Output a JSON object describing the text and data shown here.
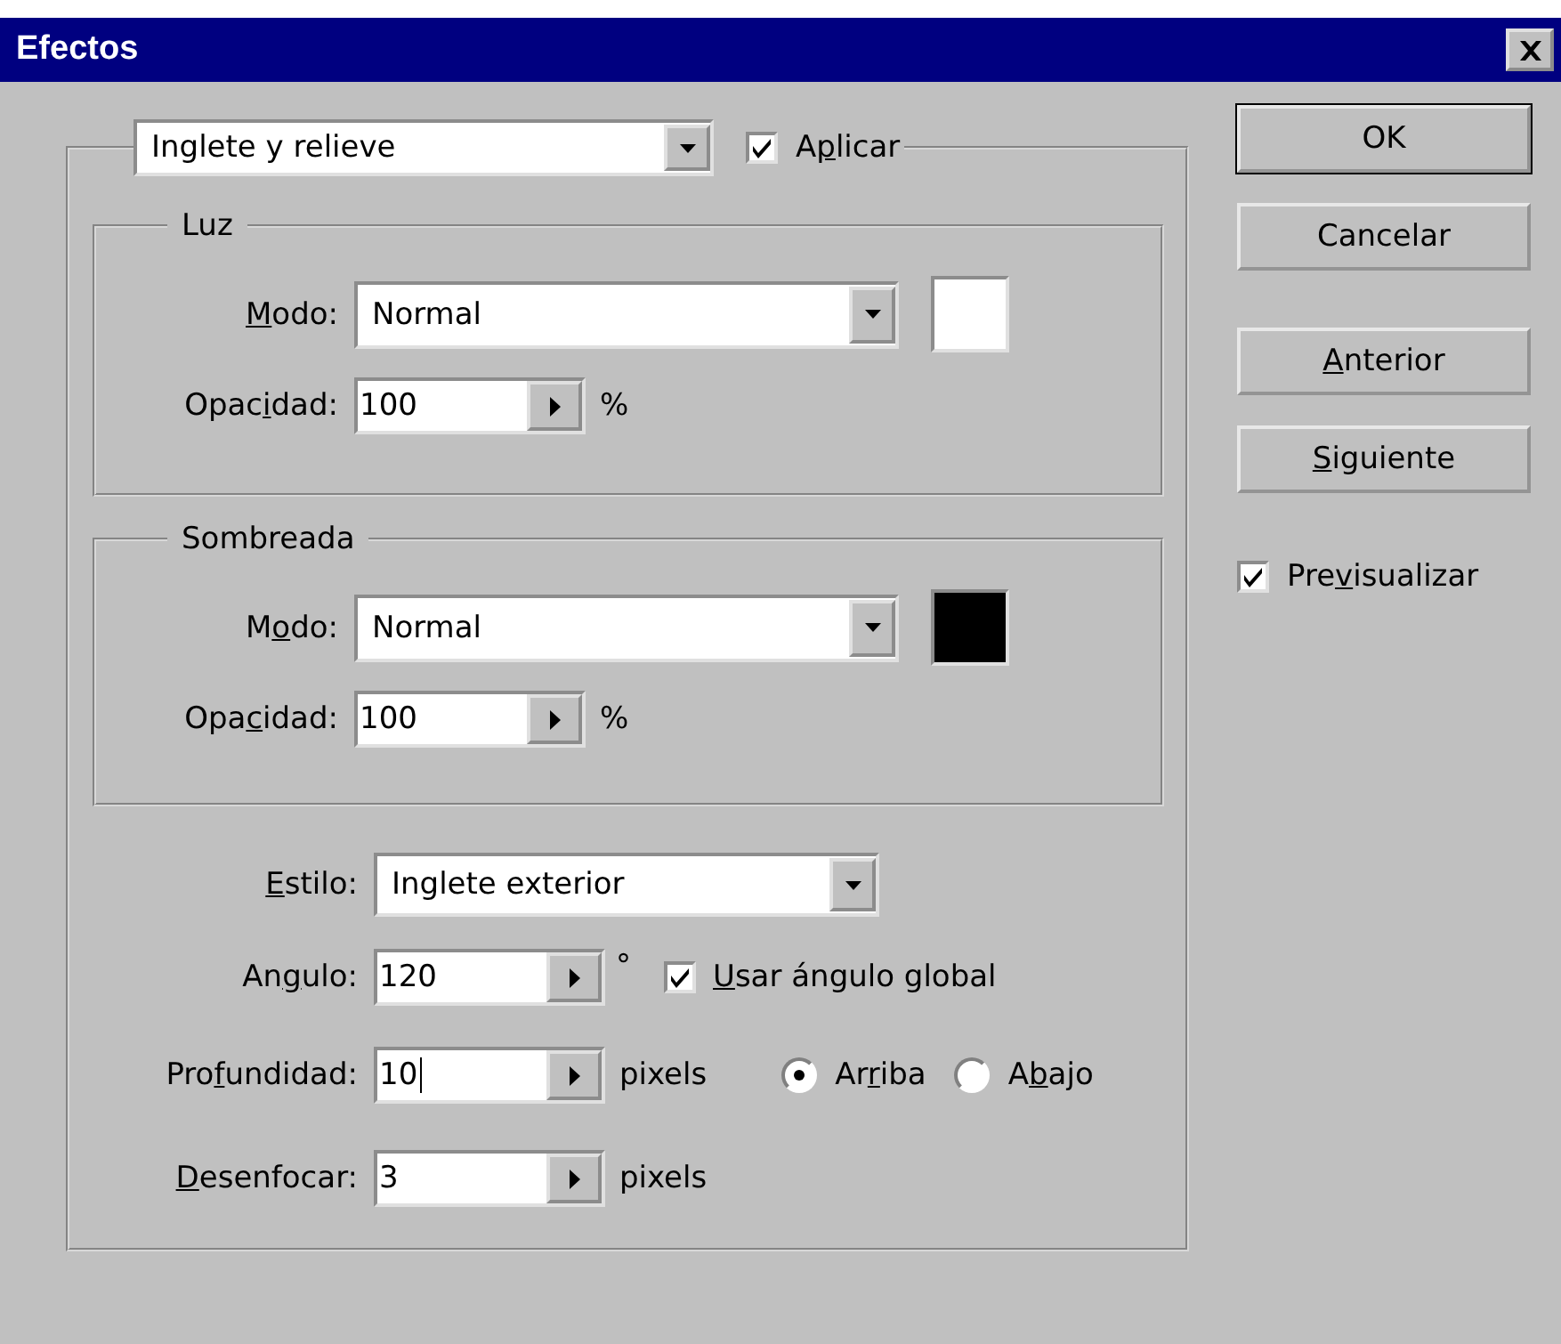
{
  "window": {
    "title": "Efectos"
  },
  "effect": {
    "value": "Inglete y relieve"
  },
  "apply": {
    "label": [
      {
        "text": "A",
        "underlined": false
      },
      {
        "text": "p",
        "underlined": true
      },
      {
        "text": "licar",
        "underlined": false
      }
    ],
    "checked": true
  },
  "groups": [
    {
      "title": "Luz",
      "mode_label": [
        {
          "text": "M",
          "underlined": true
        },
        {
          "text": "odo:",
          "underlined": false
        }
      ],
      "mode": "Normal",
      "color": "#ffffff",
      "opacity_label": [
        {
          "text": "Opac",
          "underlined": false
        },
        {
          "text": "i",
          "underlined": true
        },
        {
          "text": "dad:",
          "underlined": false
        }
      ],
      "opacity": "100",
      "unit": "%"
    },
    {
      "title": "Sombreada",
      "mode_label": [
        {
          "text": "M",
          "underlined": false
        },
        {
          "text": "o",
          "underlined": true
        },
        {
          "text": "do:",
          "underlined": false
        }
      ],
      "mode": "Normal",
      "color": "#000000",
      "opacity_label": [
        {
          "text": "Opa",
          "underlined": false
        },
        {
          "text": "c",
          "underlined": true
        },
        {
          "text": "idad:",
          "underlined": false
        }
      ],
      "opacity": "100",
      "unit": "%"
    }
  ],
  "style": {
    "label": [
      {
        "text": "E",
        "underlined": true
      },
      {
        "text": "stilo:",
        "underlined": false
      }
    ],
    "value": "Inglete exterior"
  },
  "angle": {
    "label": [
      {
        "text": "An",
        "underlined": false
      },
      {
        "text": "g",
        "underlined": true
      },
      {
        "text": "ulo:",
        "underlined": false
      }
    ],
    "value": "120",
    "unit": "°",
    "global": {
      "label": [
        {
          "text": "U",
          "underlined": true
        },
        {
          "text": "sar ángulo global",
          "underlined": false
        }
      ],
      "checked": true
    }
  },
  "depth": {
    "label": [
      {
        "text": "Pro",
        "underlined": false
      },
      {
        "text": "f",
        "underlined": true
      },
      {
        "text": "undidad:",
        "underlined": false
      }
    ],
    "value": "10",
    "focused": true,
    "unit": "pixels",
    "directions": [
      {
        "label": [
          {
            "text": "Ar",
            "underlined": false
          },
          {
            "text": "r",
            "underlined": true
          },
          {
            "text": "iba",
            "underlined": false
          }
        ],
        "selected": true
      },
      {
        "label": [
          {
            "text": "A",
            "underlined": false
          },
          {
            "text": "b",
            "underlined": true
          },
          {
            "text": "ajo",
            "underlined": false
          }
        ],
        "selected": false
      }
    ]
  },
  "blur": {
    "label": [
      {
        "text": "D",
        "underlined": true
      },
      {
        "text": "esenfocar:",
        "underlined": false
      }
    ],
    "value": "3",
    "unit": "pixels"
  },
  "buttons": [
    {
      "label": [
        {
          "text": "OK",
          "underlined": false
        }
      ],
      "default": true
    },
    {
      "label": [
        {
          "text": "Cancelar",
          "underlined": false
        }
      ],
      "default": false
    },
    {
      "label": [
        {
          "text": "A",
          "underlined": true
        },
        {
          "text": "nterior",
          "underlined": false
        }
      ],
      "default": false
    },
    {
      "label": [
        {
          "text": "S",
          "underlined": true
        },
        {
          "text": "iguiente",
          "underlined": false
        }
      ],
      "default": false
    }
  ],
  "preview": {
    "label": [
      {
        "text": "Pre",
        "underlined": false
      },
      {
        "text": "v",
        "underlined": true
      },
      {
        "text": "isualizar",
        "underlined": false
      }
    ],
    "checked": true
  }
}
